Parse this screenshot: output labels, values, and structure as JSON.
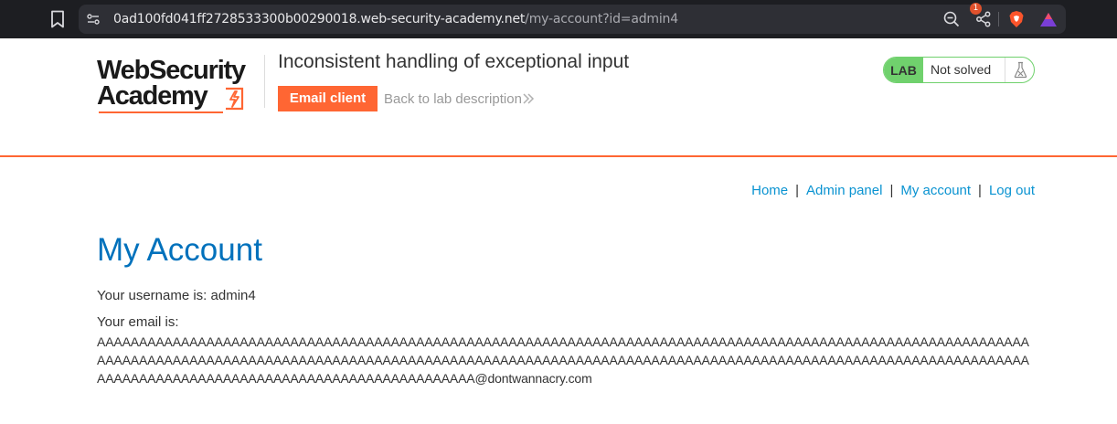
{
  "browser": {
    "url_host": "0ad100fd041ff2728533300b00290018.web-security-academy.net",
    "url_path": "/my-account?id=admin4",
    "rewards_badge": "1",
    "icons": [
      "bookmark-icon",
      "site-settings-icon",
      "zoom-icon",
      "share-icon",
      "brave-shield-icon",
      "brave-rewards-icon"
    ]
  },
  "header": {
    "logo_line1": "WebSecurity",
    "logo_line2": "Academy",
    "lab_title": "Inconsistent handling of exceptional input",
    "email_client_label": "Email client",
    "back_link_label": "Back to lab description",
    "lab_badge": "LAB",
    "lab_status": "Not solved"
  },
  "nav": {
    "home": "Home",
    "admin_panel": "Admin panel",
    "my_account": "My account",
    "log_out": "Log out",
    "separator": "|"
  },
  "main": {
    "title": "My Account",
    "username_line": "Your username is: admin4",
    "email_label": "Your email is:",
    "email_value": "AAAAAAAAAAAAAAAAAAAAAAAAAAAAAAAAAAAAAAAAAAAAAAAAAAAAAAAAAAAAAAAAAAAAAAAAAAAAAAAAAAAAAAAAAAAAAAAAAAAAAAAAAAAAAAAAAAAAAAAAAAAAAAAAAAAAAAAAAAAAAAAAAAAAAAAAAAAAAAAAAAAAAAAAAAAAAAAAAAAAAAAAAAAAAAAAAAAAAAAAAAAAAAAAAAAAAAAAAAAAAAAAAAAAAAAAAAAAAAAAAAAAAAAAAAAAAAAAAAAAAAAAAAA@dontwannacry.com"
  },
  "colors": {
    "accent_orange": "#ff6633",
    "link_blue": "#0a93d1",
    "title_blue": "#0071bc",
    "lab_green": "#70d16d"
  }
}
